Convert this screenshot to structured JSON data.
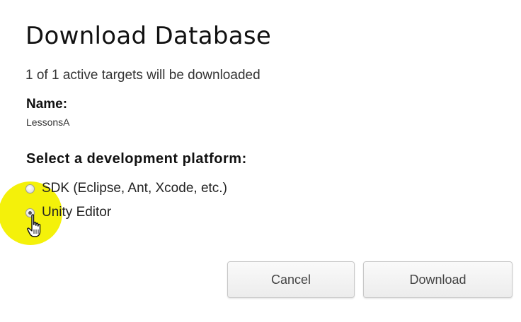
{
  "dialog": {
    "title": "Download Database",
    "subtitle": "1 of 1 active targets will be downloaded",
    "name_label": "Name:",
    "name_value": "LessonsA",
    "platform_label": "Select a development platform:",
    "options": [
      {
        "label": "SDK (Eclipse, Ant, Xcode, etc.)",
        "selected": false
      },
      {
        "label": "Unity Editor",
        "selected": true
      }
    ],
    "buttons": {
      "cancel": "Cancel",
      "download": "Download"
    }
  },
  "colors": {
    "highlight": "#f4f10a",
    "button_text": "#444444"
  },
  "icons": {
    "cursor": "hand-pointer-icon"
  }
}
